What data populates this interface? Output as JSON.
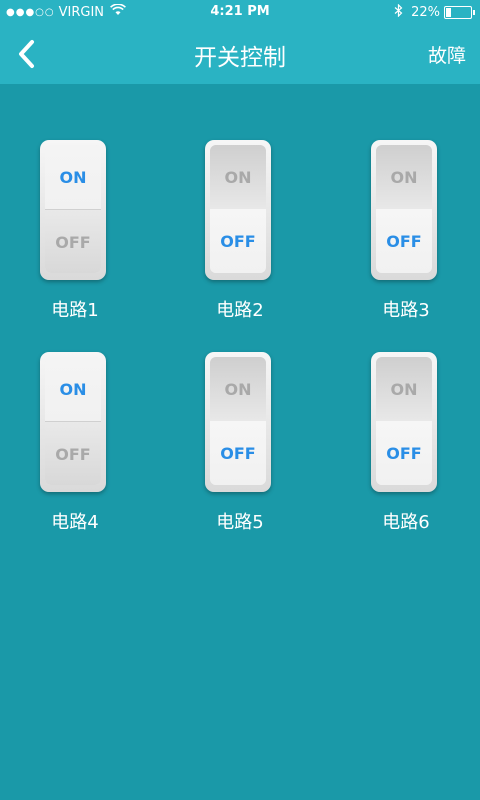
{
  "status_bar": {
    "signal": "●●●○○",
    "carrier": "VIRGIN",
    "time": "4:21 PM",
    "battery_percent": "22%",
    "battery_level": 0.22
  },
  "nav": {
    "title": "开关控制",
    "right_button": "故障"
  },
  "switches": [
    {
      "name": "电路1",
      "state": "on",
      "on_label": "ON",
      "off_label": "OFF"
    },
    {
      "name": "电路2",
      "state": "off",
      "on_label": "ON",
      "off_label": "OFF"
    },
    {
      "name": "电路3",
      "state": "off",
      "on_label": "ON",
      "off_label": "OFF"
    },
    {
      "name": "电路4",
      "state": "on",
      "on_label": "ON",
      "off_label": "OFF"
    },
    {
      "name": "电路5",
      "state": "off",
      "on_label": "ON",
      "off_label": "OFF"
    },
    {
      "name": "电路6",
      "state": "off",
      "on_label": "ON",
      "off_label": "OFF"
    }
  ],
  "colors": {
    "background": "#1a99a8",
    "header": "#2ab3c3",
    "active_label": "#2a8ee6",
    "inactive_label": "#a9a9a9"
  }
}
